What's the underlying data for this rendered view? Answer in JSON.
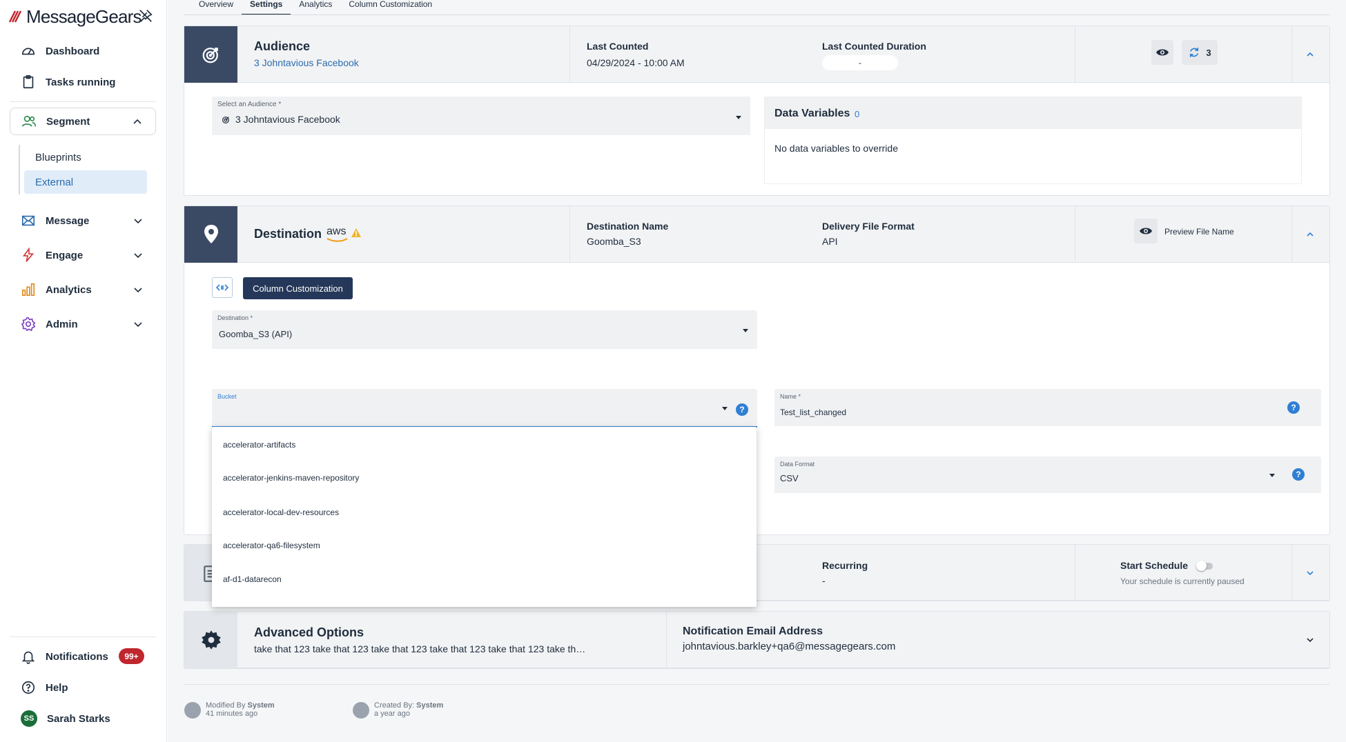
{
  "sidebar": {
    "logo_text": "MessageGears",
    "items": {
      "dashboard": "Dashboard",
      "tasks": "Tasks running",
      "segment": "Segment",
      "blueprints": "Blueprints",
      "external": "External",
      "message": "Message",
      "engage": "Engage",
      "analytics": "Analytics",
      "admin": "Admin"
    },
    "notifications": "Notifications",
    "notifications_badge": "99+",
    "help": "Help",
    "user_initials": "SS",
    "user_name": "Sarah Starks"
  },
  "tabs": [
    "Overview",
    "Settings",
    "Analytics",
    "Column Customization"
  ],
  "audience": {
    "title": "Audience",
    "subtitle": "3 Johntavious Facebook",
    "last_counted_label": "Last Counted",
    "last_counted_value": "04/29/2024 - 10:00 AM",
    "duration_label": "Last Counted Duration",
    "duration_value": "-",
    "count": "3",
    "select_label": "Select an Audience *",
    "select_value": "3 Johntavious Facebook",
    "data_vars_label": "Data Variables",
    "data_vars_count": "0",
    "data_vars_empty": "No data variables to override"
  },
  "destination": {
    "title": "Destination",
    "provider": "aws",
    "name_label": "Destination Name",
    "name_value": "Goomba_S3",
    "format_label": "Delivery File Format",
    "format_value": "API",
    "preview_label": "Preview File Name",
    "column_button": "Column Customization",
    "dest_field_label": "Destination *",
    "dest_field_value": "Goomba_S3 (API)",
    "bucket_label": "Bucket",
    "bucket_options": [
      "accelerator-artifacts",
      "accelerator-jenkins-maven-repository",
      "accelerator-local-dev-resources",
      "accelerator-qa6-filesystem",
      "af-d1-datarecon"
    ],
    "name_field_label": "Name *",
    "name_field_value": "Test_list_changed",
    "data_format_label": "Data Format",
    "data_format_value": "CSV"
  },
  "schedule": {
    "recurring_label": "Recurring",
    "recurring_value": "-",
    "start_label": "Start Schedule",
    "start_sub": "Your schedule is currently paused"
  },
  "advanced": {
    "title": "Advanced Options",
    "subtitle": "take that 123 take that 123 take that 123 take that 123 take that 123 take th…",
    "email_label": "Notification Email Address",
    "email_value": "johntavious.barkley+qa6@messagegears.com"
  },
  "meta": {
    "modified_prefix": "Modified By",
    "modified_by": "System",
    "modified_time": "41 minutes ago",
    "created_prefix": "Created By:",
    "created_by": "System",
    "created_time": "a year ago"
  },
  "colors": {
    "accent": "#2b6cb0",
    "header_dark": "#3b4a64",
    "button_dark": "#253859",
    "badge": "#c0262d"
  }
}
